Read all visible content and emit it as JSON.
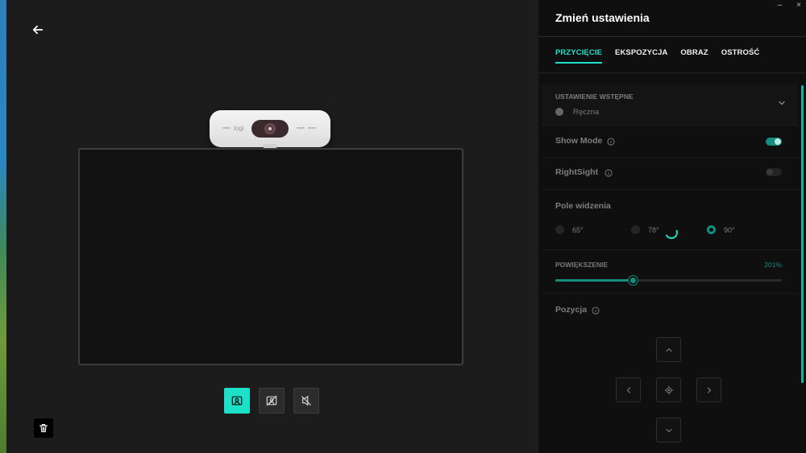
{
  "panel": {
    "title": "Zmień ustawienia",
    "window_controls": {
      "minimize": "–",
      "close": "×"
    },
    "tabs": [
      {
        "label": "PRZYCIĘCIE",
        "active": true
      },
      {
        "label": "EKSPOZYCJA",
        "active": false
      },
      {
        "label": "OBRAZ",
        "active": false
      },
      {
        "label": "OSTROŚĆ",
        "active": false
      }
    ],
    "preset": {
      "label": "USTAWIENIE WSTĘPNE",
      "value": "Ręczna"
    },
    "show_mode": {
      "label": "Show Mode",
      "on": true
    },
    "rightsight": {
      "label": "RightSight",
      "on": false
    },
    "fov": {
      "label": "Pole widzenia",
      "options": [
        {
          "label": "65°",
          "selected": false
        },
        {
          "label": "78°",
          "selected": false
        },
        {
          "label": "90°",
          "selected": true
        }
      ]
    },
    "zoom": {
      "label": "POWIĘKSZENIE",
      "value": "201%",
      "fraction": 0.34
    },
    "position": {
      "label": "Pozycja"
    }
  },
  "camera": {
    "brand": "logi"
  },
  "colors": {
    "accent": "#1de0c9",
    "accent_dim": "#138e80",
    "panel_bg": "#0f0f0f",
    "main_bg": "#1c1c1c"
  },
  "icons": {
    "back": "arrow-left-icon",
    "modes": [
      "person-frame-icon",
      "background-blur-off-icon",
      "mic-off-icon"
    ],
    "trash": "trash-icon",
    "info": "info-icon",
    "chevron": "chevron-down-icon",
    "pad": [
      "chevron-up-icon",
      "chevron-left-icon",
      "crosshair-icon",
      "chevron-right-icon",
      "chevron-down-icon"
    ]
  }
}
